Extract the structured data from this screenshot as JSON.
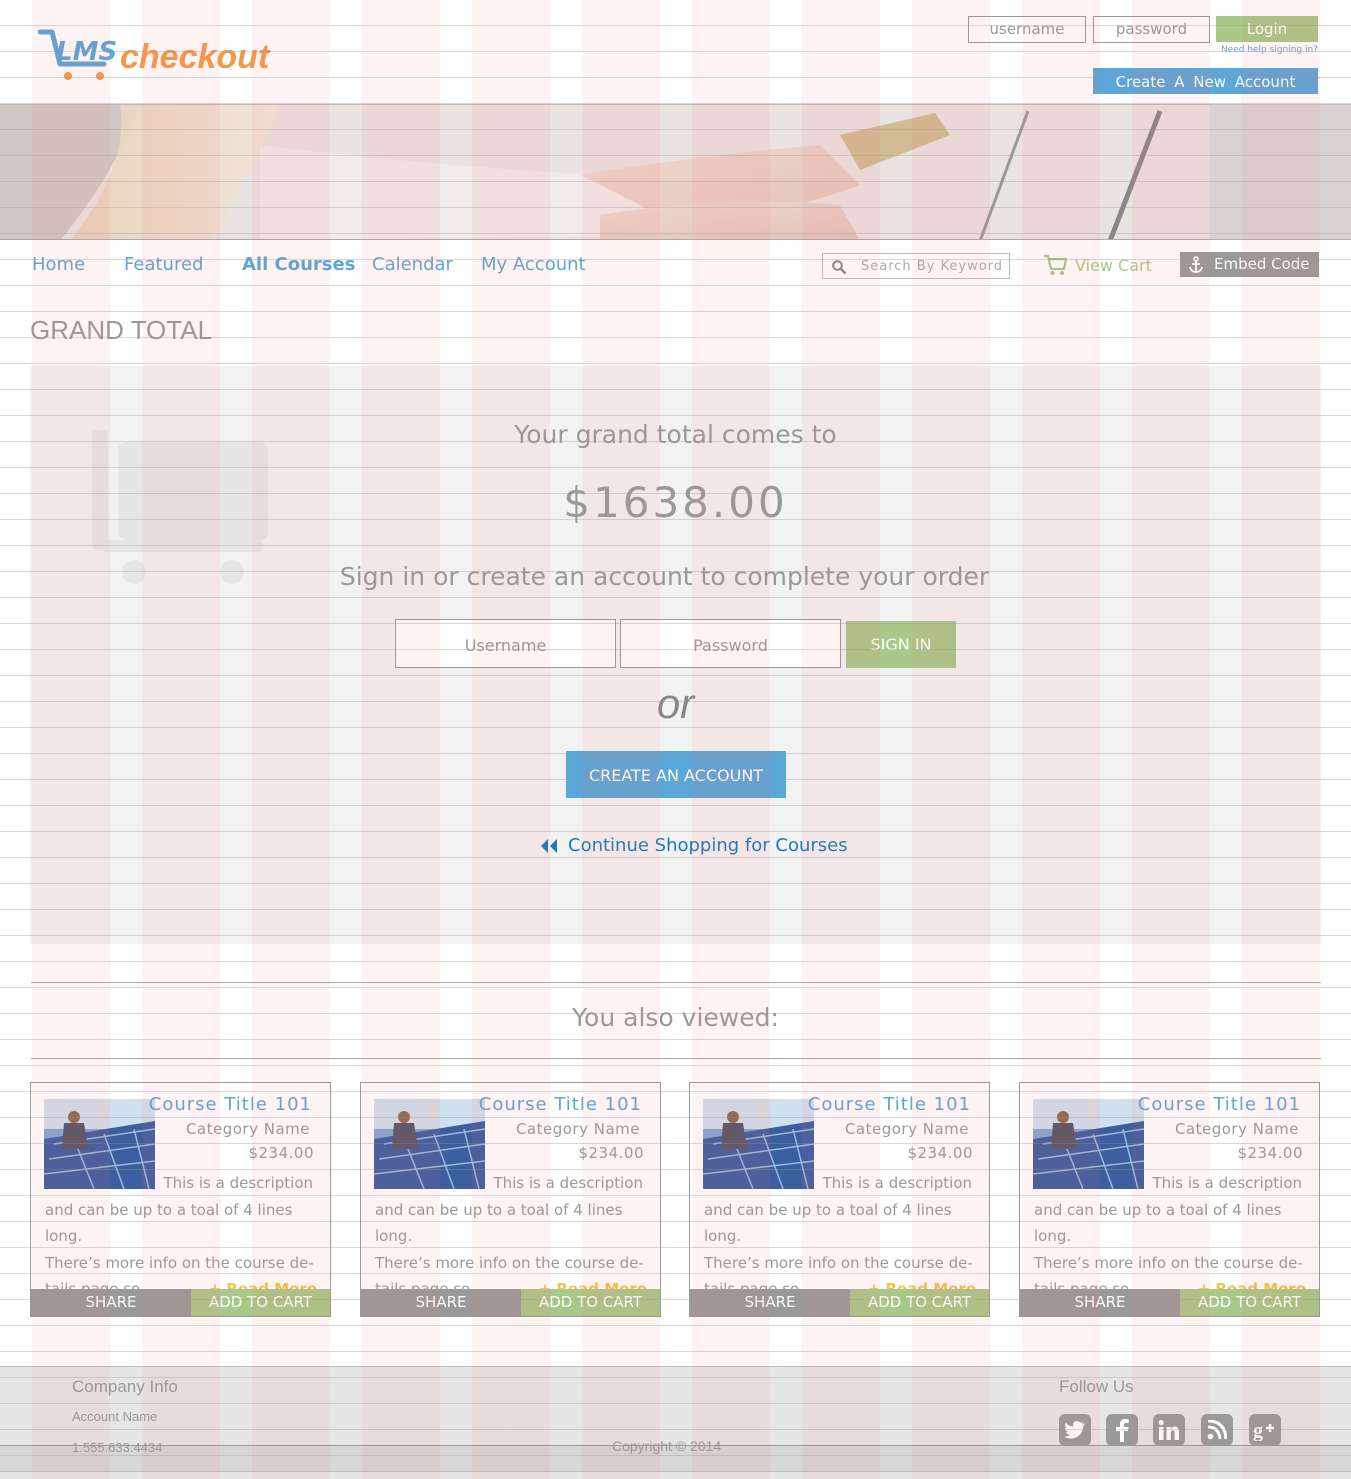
{
  "header": {
    "logo_lms": "LMS",
    "logo_word": "checkout",
    "username_placeholder": "username",
    "password_placeholder": "password",
    "login_label": "Login",
    "help_link": "Need help signing in?",
    "create_account_label": "Create A New Account"
  },
  "nav": {
    "items": [
      {
        "label": "Home"
      },
      {
        "label": "Featured"
      },
      {
        "label": "All Courses",
        "active": true
      },
      {
        "label": "Calendar"
      },
      {
        "label": "My Account"
      }
    ],
    "search_placeholder": "Search By Keyword",
    "view_cart_label": "View Cart",
    "embed_label": "Embed Code"
  },
  "page": {
    "title": "GRAND TOTAL"
  },
  "panel": {
    "intro": "Your grand total comes to",
    "total": "$1638.00",
    "prompt": "Sign in or create an account to complete your order",
    "username_placeholder": "Username",
    "password_placeholder": "Password",
    "signin_label": "SIGN IN",
    "or_text": "or",
    "create_label": "CREATE AN ACCOUNT",
    "continue_label": "Continue Shopping for Courses"
  },
  "also": {
    "heading": "You also viewed:",
    "cards": [
      {
        "title": "Course Title 101",
        "category": "Category Name",
        "price": "$234.00",
        "desc_l1": "This is a description",
        "desc_l2": "and can be up to a toal of 4 lines long.",
        "desc_l3": "There’s more info on the course de-",
        "desc_l4": "tails page so...",
        "read_more": "+ Read More",
        "share": "SHARE",
        "add": "ADD TO CART"
      },
      {
        "title": "Course Title 101",
        "category": "Category Name",
        "price": "$234.00",
        "desc_l1": "This is a description",
        "desc_l2": "and can be up to a toal of 4 lines long.",
        "desc_l3": "There’s more info on the course de-",
        "desc_l4": "tails page so...",
        "read_more": "+ Read More",
        "share": "SHARE",
        "add": "ADD TO CART"
      },
      {
        "title": "Course Title 101",
        "category": "Category Name",
        "price": "$234.00",
        "desc_l1": "This is a description",
        "desc_l2": "and can be up to a toal of 4 lines long.",
        "desc_l3": "There’s more info on the course de-",
        "desc_l4": "tails page so...",
        "read_more": "+ Read More",
        "share": "SHARE",
        "add": "ADD TO CART"
      },
      {
        "title": "Course Title 101",
        "category": "Category Name",
        "price": "$234.00",
        "desc_l1": "This is a description",
        "desc_l2": "and can be up to a toal of 4 lines long.",
        "desc_l3": "There’s more info on the course de-",
        "desc_l4": "tails page so...",
        "read_more": "+ Read More",
        "share": "SHARE",
        "add": "ADD TO CART"
      }
    ]
  },
  "footer": {
    "company_heading": "Company Info",
    "account_name": "Account Name",
    "phone": "1.555.633.4434",
    "copyright": "Copyright © 2014",
    "follow_heading": "Follow Us",
    "social_icons": [
      "twitter-icon",
      "facebook-icon",
      "linkedin-icon",
      "rss-icon",
      "google-plus-icon"
    ]
  },
  "colors": {
    "accent_blue": "#5aa7d8",
    "accent_green": "#a8c98a",
    "accent_orange": "#f29a4b",
    "link_blue": "#1a7ab8",
    "read_more_yellow": "#f2c24b"
  }
}
